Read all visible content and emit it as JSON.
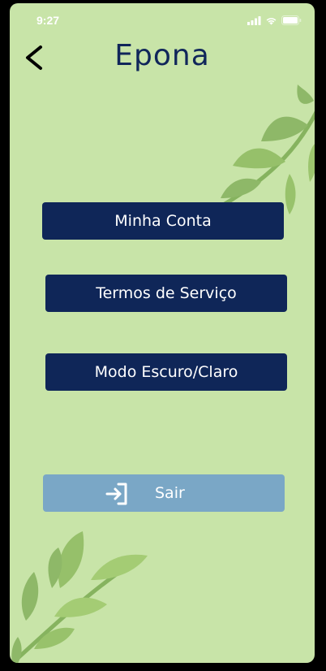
{
  "status_bar": {
    "time": "9:27",
    "icons": [
      "signal-icon",
      "wifi-icon",
      "battery-icon"
    ]
  },
  "header": {
    "title": "Epona",
    "back_icon": "chevron-left-icon"
  },
  "menu": {
    "account_label": "Minha Conta",
    "terms_label": "Termos de Serviço",
    "mode_label": "Modo Escuro/Claro"
  },
  "logout": {
    "label": "Sair",
    "icon": "sign-in-icon"
  },
  "colors": {
    "background": "#c8e4a8",
    "primary": "#0f2658",
    "logout": "#7aa7c6",
    "leaf_dark": "#8eb868",
    "leaf_light": "#a4cc74"
  }
}
